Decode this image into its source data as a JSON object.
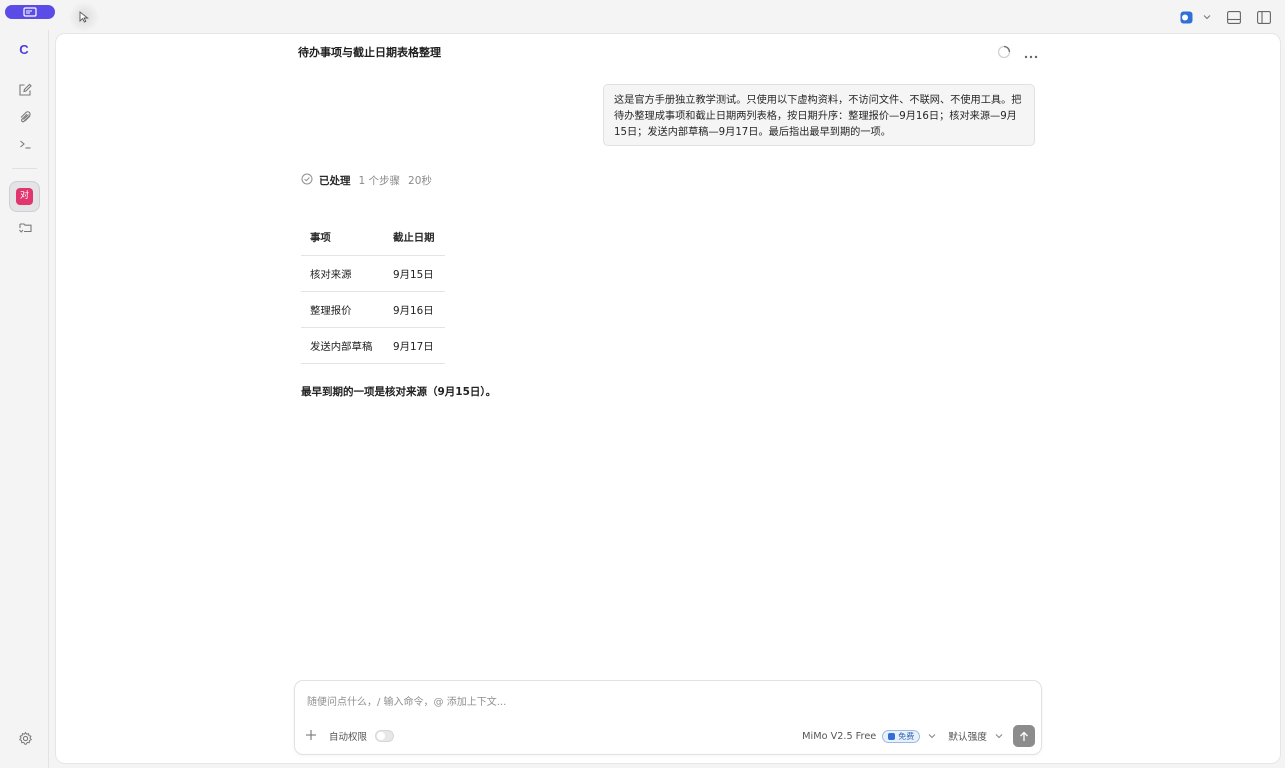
{
  "topbar": {
    "app_icon": "app-window-icon",
    "cursor_icon": "cursor-arrow-icon",
    "right_icons": [
      "browser-profile-icon",
      "chevron-down-icon",
      "panel-bottom-icon",
      "panel-right-icon"
    ]
  },
  "rail": {
    "logo": "C",
    "items": [
      {
        "name": "new-chat",
        "icon": "edit-icon"
      },
      {
        "name": "attachments",
        "icon": "paperclip-icon"
      },
      {
        "name": "terminal",
        "icon": "terminal-icon"
      },
      {
        "name": "conversation",
        "icon_label": "对"
      },
      {
        "name": "folders",
        "icon": "folder-sync-icon"
      }
    ],
    "settings_icon": "gear-icon"
  },
  "conversation": {
    "title": "待办事项与截止日期表格整理",
    "user_message": "这是官方手册独立教学测试。只使用以下虚构资料，不访问文件、不联网、不使用工具。把待办整理成事项和截止日期两列表格，按日期升序：整理报价—9月16日；核对来源—9月15日；发送内部草稿—9月17日。最后指出最早到期的一项。",
    "processed": {
      "label": "已处理",
      "steps": "1 个步骤",
      "duration": "20秒"
    },
    "table": {
      "headers": [
        "事项",
        "截止日期"
      ],
      "rows": [
        [
          "核对来源",
          "9月15日"
        ],
        [
          "整理报价",
          "9月16日"
        ],
        [
          "发送内部草稿",
          "9月17日"
        ]
      ]
    },
    "answer": "最早到期的一项是核对来源（9月15日）。"
  },
  "composer": {
    "placeholder": "随便问点什么，/ 输入命令，@ 添加上下文...",
    "auto_permission_label": "自动权限",
    "auto_permission_on": false,
    "model": "MiMo V2.5 Free",
    "model_badge": "免费",
    "strength": "默认强度"
  },
  "colors": {
    "accent": "#5b4ce8",
    "chip": "#e0356f",
    "badge": "#2f6fd6"
  }
}
